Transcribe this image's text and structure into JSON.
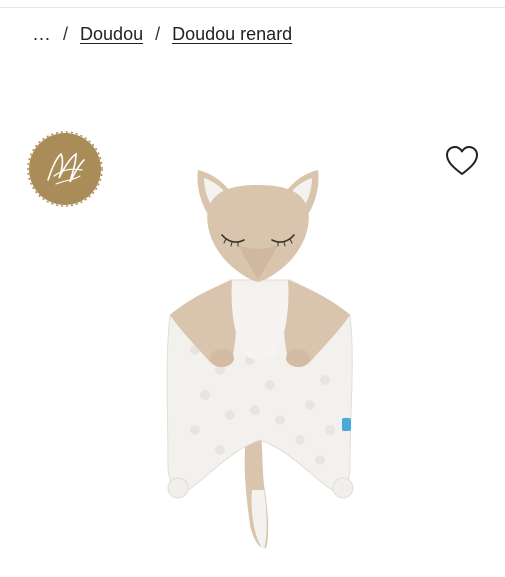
{
  "breadcrumb": {
    "ellipsis": "...",
    "separator": "/",
    "items": [
      {
        "label": "Doudou"
      },
      {
        "label": "Doudou renard"
      }
    ]
  },
  "product": {
    "badge_icon": "brand-monogram-icon",
    "wishlist_icon": "heart-icon",
    "image_subject": "fox-comforter-image"
  },
  "colors": {
    "badge_gold": "#a98c57",
    "text": "#222222",
    "beige": "#d9c4ad",
    "cream": "#f3f1ee"
  }
}
